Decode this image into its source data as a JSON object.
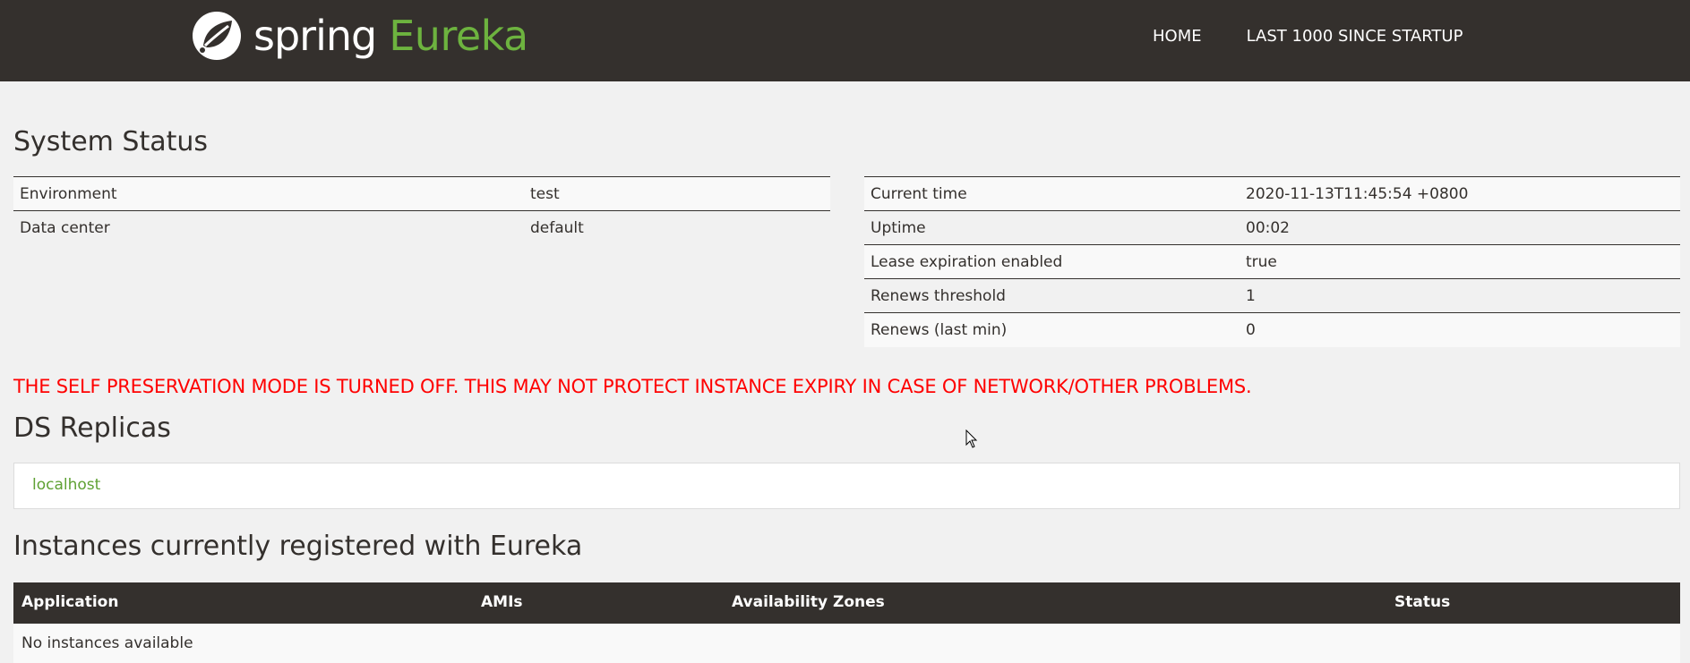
{
  "brand": {
    "logo_icon": "spring-leaf-icon",
    "name": "spring",
    "product": "Eureka",
    "accent_color": "#6db33f"
  },
  "nav": {
    "home": "HOME",
    "last1000": "LAST 1000 SINCE STARTUP"
  },
  "system_status": {
    "title": "System Status",
    "left": [
      {
        "label": "Environment",
        "value": "test"
      },
      {
        "label": "Data center",
        "value": "default"
      }
    ],
    "right": [
      {
        "label": "Current time",
        "value": "2020-11-13T11:45:54 +0800"
      },
      {
        "label": "Uptime",
        "value": "00:02"
      },
      {
        "label": "Lease expiration enabled",
        "value": "true"
      },
      {
        "label": "Renews threshold",
        "value": "1"
      },
      {
        "label": "Renews (last min)",
        "value": "0"
      }
    ]
  },
  "warning": "THE SELF PRESERVATION MODE IS TURNED OFF. THIS MAY NOT PROTECT INSTANCE EXPIRY IN CASE OF NETWORK/OTHER PROBLEMS.",
  "ds_replicas": {
    "title": "DS Replicas",
    "items": [
      "localhost"
    ]
  },
  "instances": {
    "title": "Instances currently registered with Eureka",
    "columns": [
      "Application",
      "AMIs",
      "Availability Zones",
      "Status"
    ],
    "empty_text": "No instances available"
  }
}
